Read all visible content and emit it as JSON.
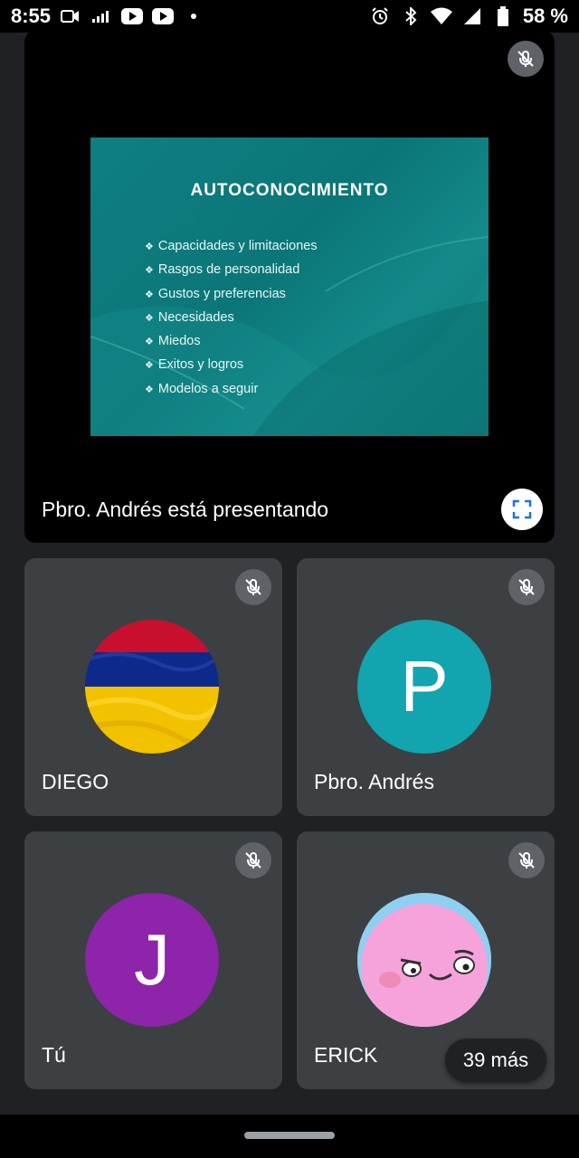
{
  "status_bar": {
    "time": "8:55",
    "battery_percent": "58 %",
    "left_icons": [
      "video-camera-icon",
      "signal-bars-icon",
      "youtube-icon",
      "youtube-icon",
      "dot-icon"
    ],
    "right_icons": [
      "alarm-icon",
      "bluetooth-icon",
      "wifi-icon",
      "cell-signal-icon",
      "battery-icon"
    ]
  },
  "presentation": {
    "slide": {
      "title": "AUTOCONOCIMIENTO",
      "bullet_glyph": "❖",
      "items": [
        "Capacidades y limitaciones",
        "Rasgos de personalidad",
        "Gustos y preferencias",
        "Necesidades",
        "Miedos",
        "Exitos y logros",
        "Modelos a seguir"
      ],
      "background_color": "#0f7f82"
    },
    "presenting_label": "Pbro. Andrés está presentando"
  },
  "participants": [
    {
      "name": "DIEGO",
      "avatar_type": "flag",
      "muted": true
    },
    {
      "name": "Pbro. Andrés",
      "avatar_letter": "P",
      "avatar_color": "#12a4af",
      "muted": true
    },
    {
      "name": "Tú",
      "avatar_letter": "J",
      "avatar_color": "#8e24aa",
      "muted": true
    },
    {
      "name": "ERICK",
      "avatar_type": "cartoon",
      "muted": true
    }
  ],
  "more_participants": "39 más",
  "colors": {
    "background": "#202124",
    "tile": "#3c4043",
    "mute_badge": "#5f6368"
  }
}
